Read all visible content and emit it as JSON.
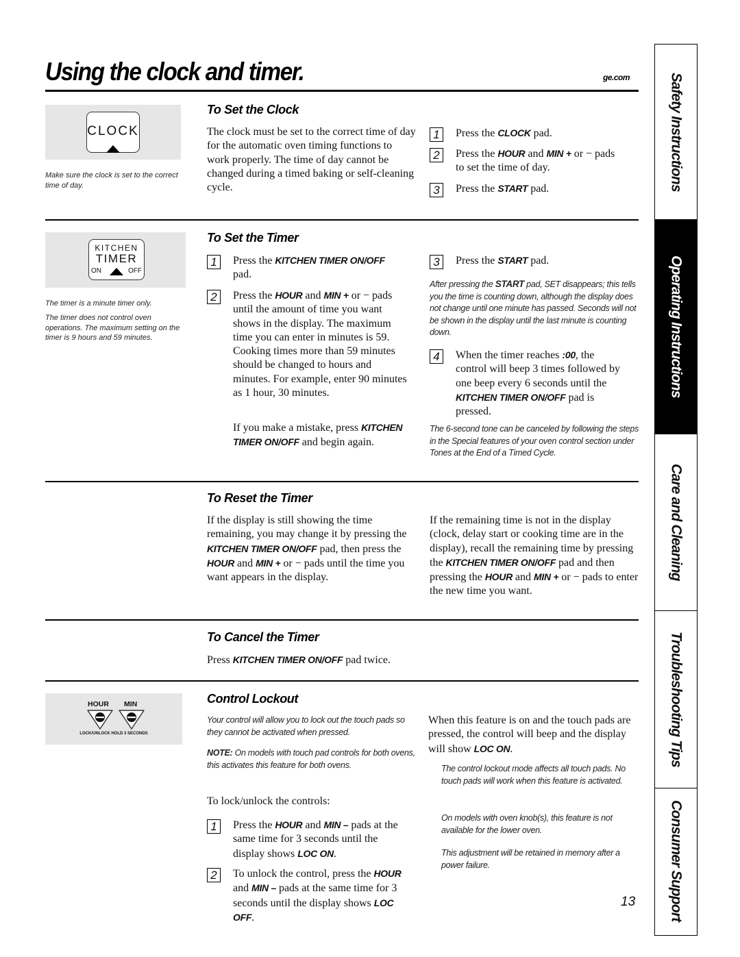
{
  "header": {
    "title": "Using the clock and timer.",
    "site": "ge.com"
  },
  "side_tabs": [
    {
      "label": "Safety Instructions",
      "active": false
    },
    {
      "label": "Operating Instructions",
      "active": true
    },
    {
      "label": "Care and Cleaning",
      "active": false
    },
    {
      "label": "Troubleshooting Tips",
      "active": false
    },
    {
      "label": "Consumer Support",
      "active": false
    }
  ],
  "set_clock": {
    "pad_label": "CLOCK",
    "caption": "Make sure the clock is set to the correct time of day.",
    "heading": "To Set the Clock",
    "intro": "The clock must be set to the correct time of day for the automatic oven timing functions to work properly. The time of day cannot be changed during a timed baking or self-cleaning cycle.",
    "steps": [
      {
        "num": "1",
        "pre": "Press the ",
        "kw1": "CLOCK",
        "mid": " pad.",
        "kw2": "",
        "post": ""
      },
      {
        "num": "2",
        "pre": "Press the ",
        "kw1": "HOUR",
        "mid": " and ",
        "kw2": "MIN +",
        "post": " or − pads to set the time of day."
      },
      {
        "num": "3",
        "pre": "Press the ",
        "kw1": "START",
        "mid": " pad.",
        "kw2": "",
        "post": ""
      }
    ]
  },
  "set_timer": {
    "pad_line1": "KITCHEN",
    "pad_line2": "TIMER",
    "pad_on": "ON",
    "pad_off": "OFF",
    "caption1": "The timer is a minute timer only.",
    "caption2": "The timer does not control oven operations. The maximum setting on the timer is 9 hours and 59 minutes.",
    "heading": "To Set the Timer",
    "step1": {
      "num": "1",
      "pre": "Press the ",
      "kw": "KITCHEN TIMER ON/OFF",
      "post": " pad."
    },
    "step2": {
      "num": "2",
      "pre": "Press the ",
      "kw1": "HOUR",
      "mid": " and ",
      "kw2": "MIN +",
      "post": " or − pads until the amount of time you want shows in the display. The maximum time you can enter in minutes is 59. Cooking times more than 59 minutes should be changed to hours and minutes. For example, enter 90 minutes as 1 hour, 30 minutes."
    },
    "mistake": {
      "pre": "If you make a mistake, press ",
      "kw": "KITCHEN TIMER ON/OFF",
      "post": " and begin again."
    },
    "step3": {
      "num": "3",
      "pre": "Press the ",
      "kw": "START",
      "post": " pad."
    },
    "step3_note": {
      "pre": "After pressing the ",
      "kw": "START",
      "post": " pad, SET disappears; this tells you the time is counting down, although the display does not change until one minute has passed. Seconds will not be shown in the display until the last minute is counting down."
    },
    "step4": {
      "num": "4",
      "pre": "When the timer reaches ",
      "kw1": ":00",
      "mid": ", the control will beep 3 times followed by one beep every 6 seconds until the ",
      "kw2": "KITCHEN TIMER ON/OFF",
      "post": " pad is pressed."
    },
    "step4_note": "The 6-second tone can be canceled by following the steps in the Special features of your oven control section under Tones at the End of a Timed Cycle."
  },
  "reset_timer": {
    "heading": "To Reset the Timer",
    "left": {
      "p1": "If the display is still showing the time remaining, you may change it by pressing the ",
      "kw1": "KITCHEN TIMER ON/OFF",
      "p2": " pad, then press the ",
      "kw2": "HOUR",
      "p3": " and ",
      "kw3": "MIN +",
      "p4": " or − pads until the time you want appears in the display."
    },
    "right": {
      "p1": "If the remaining time is not in the display (clock, delay start or cooking time are in the display), recall the remaining time by pressing the ",
      "kw1": "KITCHEN TIMER ON/OFF",
      "p2": " pad and then pressing the ",
      "kw2": "HOUR",
      "p3": " and ",
      "kw3": "MIN +",
      "p4": " or − pads to enter the new time you want."
    }
  },
  "cancel_timer": {
    "heading": "To Cancel the Timer",
    "pre": "Press ",
    "kw": "KITCHEN TIMER ON/OFF",
    "post": " pad twice."
  },
  "control_lockout": {
    "pad_hour": "HOUR",
    "pad_min": "MIN",
    "pad_caption": "LOCK/UNLOCK HOLD 3 SECONDS",
    "heading": "Control Lockout",
    "intro": "Your control will allow you to lock out the touch pads so they cannot be activated when pressed.",
    "note_kw": "NOTE:",
    "note_text": " On models with touch pad controls for both ovens, this activates this feature for both ovens.",
    "lock_intro": "To lock/unlock the controls:",
    "step1": {
      "num": "1",
      "pre": "Press the ",
      "kw1": "HOUR",
      "mid": " and ",
      "kw2": "MIN –",
      "post": " pads at the same time for 3 seconds until the display shows ",
      "kw3": "LOC ON",
      "end": "."
    },
    "step2": {
      "num": "2",
      "pre": "To unlock the control, press the ",
      "kw1": "HOUR",
      "mid": " and ",
      "kw2": "MIN –",
      "post": " pads at the same time for 3 seconds until the display shows ",
      "kw3": "LOC OFF",
      "end": "."
    },
    "right_p": {
      "pre": "When this feature is on and the touch pads are pressed, the control will beep and the display will show ",
      "kw": "LOC ON",
      "post": "."
    },
    "notes": [
      "The control lockout mode affects all touch pads. No touch pads will work when this feature is activated.",
      "On models with oven knob(s), this feature is not available for the lower oven.",
      "This adjustment will be retained in memory after a power failure."
    ]
  },
  "footer": {
    "page_number": "13"
  }
}
